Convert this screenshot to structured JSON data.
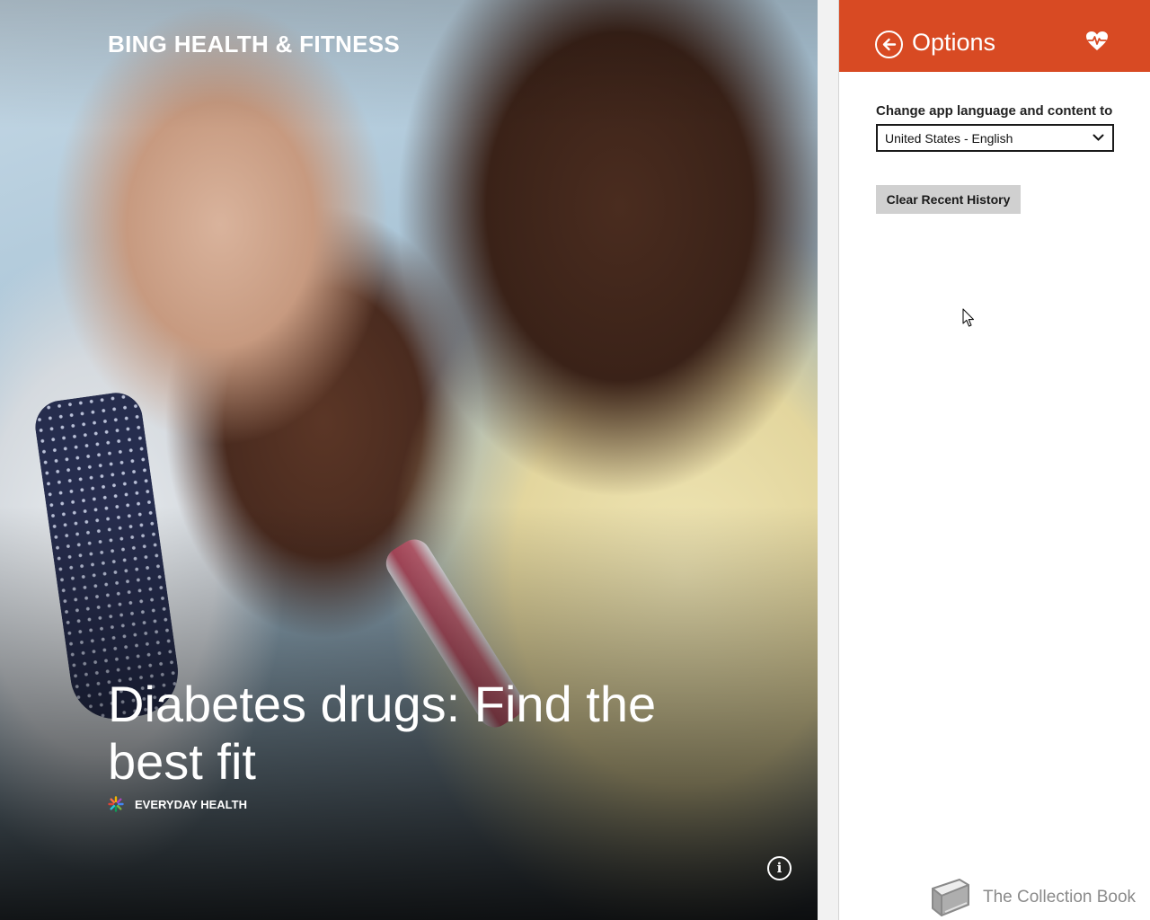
{
  "hero": {
    "app_title": "BING HEALTH & FITNESS",
    "headline": "Diabetes drugs: Find the best fit",
    "source": "EVERYDAY HEALTH",
    "info_icon": "info-icon"
  },
  "options_panel": {
    "title": "Options",
    "accent_color": "#d84a23",
    "back_icon": "back-arrow-icon",
    "app_icon": "heart-pulse-icon",
    "language_label": "Change app language and content to",
    "language_selected": "United States - English",
    "clear_history_label": "Clear Recent History"
  },
  "watermark": {
    "text": "The Collection Book"
  }
}
